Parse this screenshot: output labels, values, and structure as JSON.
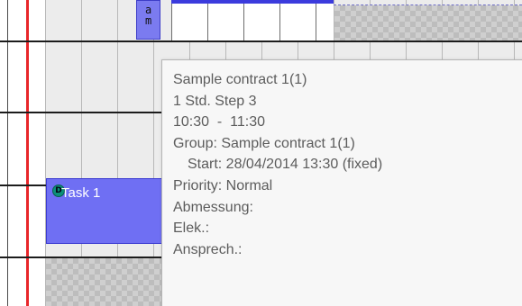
{
  "mini_task": {
    "text": "a\nm"
  },
  "task": {
    "label": "Task 1",
    "badge": "D"
  },
  "tooltip": {
    "contract": "Sample contract 1(1)",
    "step": "1 Std. Step 3",
    "time": "10:30  -  11:30",
    "group": "Group: Sample contract 1(1)",
    "start": "Start: 28/04/2014 13:30 (fixed)",
    "priority": "Priority: Normal",
    "abmessung": "Abmessung:",
    "elek": "Elek.:",
    "ansprech": "Ansprech.:"
  },
  "colors": {
    "task_fill": "#6f6ff3",
    "today_line": "#e8262a",
    "tooltip_bg": "#f7f7f7"
  }
}
